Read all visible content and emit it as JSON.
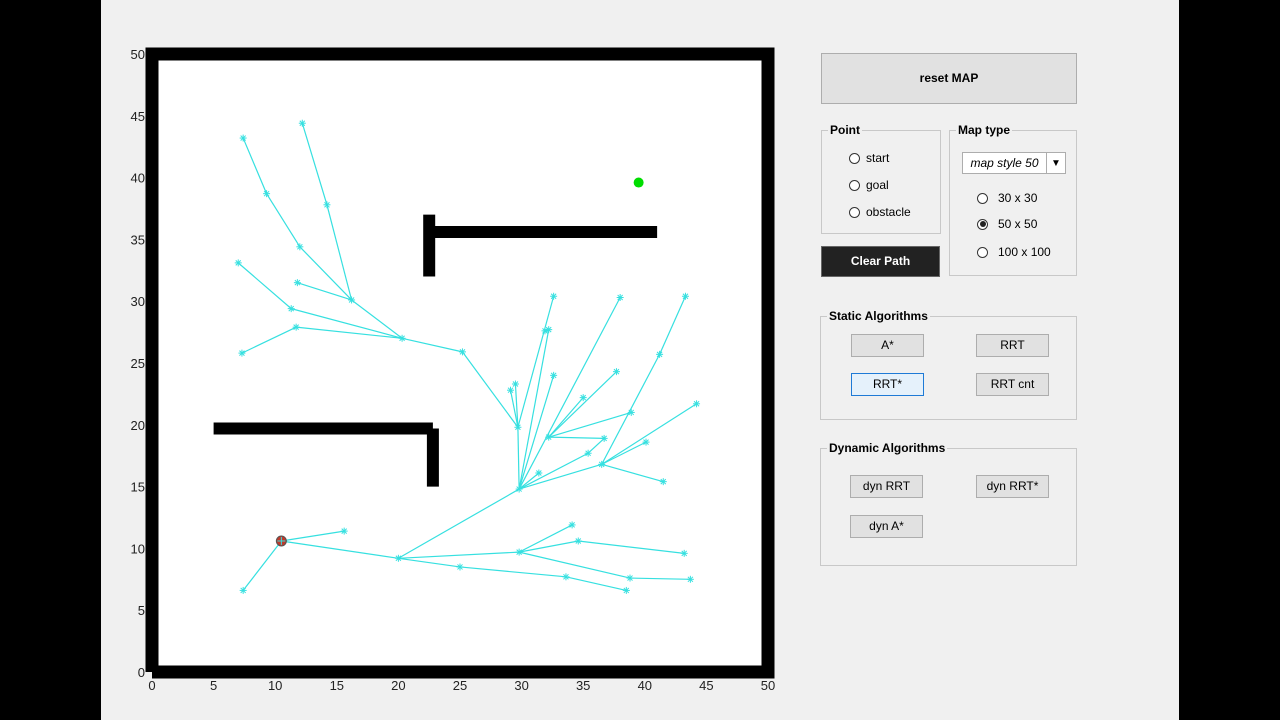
{
  "axes": {
    "xticks": [
      "0",
      "5",
      "10",
      "15",
      "20",
      "25",
      "30",
      "35",
      "40",
      "45",
      "50"
    ],
    "yticks": [
      "0",
      "5",
      "10",
      "15",
      "20",
      "25",
      "30",
      "35",
      "40",
      "45",
      "50"
    ],
    "tree_color": "#36e0e0",
    "start_color": "#c0392b",
    "goal_color": "#00dd00"
  },
  "controls": {
    "reset_label": "reset  MAP",
    "point_title": "Point",
    "point_options": [
      "start",
      "goal",
      "obstacle"
    ],
    "maptype_title": "Map type",
    "map_select_value": "map style 50",
    "size_options": [
      "30 x 30",
      "50 x 50",
      "100 x 100"
    ],
    "size_selected": "50 x 50",
    "clear_label": "Clear Path",
    "static_title": "Static Algorithms",
    "astar_label": "A*",
    "rrt_label": "RRT",
    "rrtstar_label": "RRT*",
    "rrtcnt_label": "RRT cnt",
    "dynamic_title": "Dynamic Algorithms",
    "dynrrt_label": "dyn RRT",
    "dynrrtstar_label": "dyn RRT*",
    "dynastar_label": "dyn A*"
  },
  "chart_data": {
    "type": "scatter",
    "xlim": [
      0,
      50
    ],
    "ylim": [
      0,
      50
    ],
    "start": [
      10.5,
      10.6
    ],
    "goal": [
      39.5,
      39.6
    ],
    "obstacles": [
      [
        [
          0,
          0
        ],
        [
          50,
          0
        ],
        [
          50,
          50
        ],
        [
          0,
          50
        ],
        [
          0,
          0
        ]
      ],
      [
        [
          22.5,
          32
        ],
        [
          22.5,
          37
        ]
      ],
      [
        [
          22.5,
          35.6
        ],
        [
          41,
          35.6
        ]
      ],
      [
        [
          5,
          19.7
        ],
        [
          22.8,
          19.7
        ]
      ],
      [
        [
          22.8,
          15
        ],
        [
          22.8,
          19.7
        ]
      ]
    ],
    "nodes": [
      [
        10.5,
        10.6
      ],
      [
        7.4,
        6.6
      ],
      [
        15.6,
        11.4
      ],
      [
        20,
        9.2
      ],
      [
        25,
        8.5
      ],
      [
        33.6,
        7.7
      ],
      [
        38.5,
        6.6
      ],
      [
        29.8,
        9.7
      ],
      [
        34.1,
        11.9
      ],
      [
        34.6,
        10.6
      ],
      [
        43.2,
        9.6
      ],
      [
        38.8,
        7.6
      ],
      [
        43.7,
        7.5
      ],
      [
        29.8,
        14.8
      ],
      [
        31.4,
        16.1
      ],
      [
        36.5,
        16.8
      ],
      [
        41.5,
        15.4
      ],
      [
        40.1,
        18.6
      ],
      [
        44.2,
        21.7
      ],
      [
        35.4,
        17.7
      ],
      [
        36.7,
        18.9
      ],
      [
        32.2,
        19.0
      ],
      [
        35.0,
        22.2
      ],
      [
        38.9,
        21.0
      ],
      [
        37.7,
        24.3
      ],
      [
        32.6,
        24.0
      ],
      [
        32.2,
        27.7
      ],
      [
        29.7,
        19.8
      ],
      [
        29.5,
        23.3
      ],
      [
        29.1,
        22.8
      ],
      [
        32.6,
        30.4
      ],
      [
        38.0,
        30.3
      ],
      [
        41.2,
        25.7
      ],
      [
        43.3,
        30.4
      ],
      [
        31.9,
        27.6
      ],
      [
        25.2,
        25.9
      ],
      [
        20.3,
        27.0
      ],
      [
        11.7,
        27.9
      ],
      [
        7.3,
        25.8
      ],
      [
        11.3,
        29.4
      ],
      [
        16.2,
        30.1
      ],
      [
        11.8,
        31.5
      ],
      [
        7.0,
        33.1
      ],
      [
        12.0,
        34.4
      ],
      [
        9.3,
        38.7
      ],
      [
        7.4,
        43.2
      ],
      [
        14.2,
        37.8
      ],
      [
        12.2,
        44.4
      ]
    ],
    "edges": [
      [
        0,
        1
      ],
      [
        0,
        2
      ],
      [
        0,
        3
      ],
      [
        3,
        4
      ],
      [
        4,
        5
      ],
      [
        5,
        6
      ],
      [
        3,
        7
      ],
      [
        7,
        8
      ],
      [
        7,
        9
      ],
      [
        9,
        10
      ],
      [
        7,
        11
      ],
      [
        11,
        12
      ],
      [
        3,
        13
      ],
      [
        13,
        14
      ],
      [
        13,
        15
      ],
      [
        15,
        16
      ],
      [
        15,
        17
      ],
      [
        15,
        18
      ],
      [
        13,
        19
      ],
      [
        19,
        20
      ],
      [
        20,
        21
      ],
      [
        21,
        22
      ],
      [
        21,
        23
      ],
      [
        21,
        24
      ],
      [
        13,
        25
      ],
      [
        13,
        26
      ],
      [
        26,
        34
      ],
      [
        13,
        27
      ],
      [
        27,
        28
      ],
      [
        27,
        29
      ],
      [
        27,
        35
      ],
      [
        27,
        30
      ],
      [
        13,
        31
      ],
      [
        15,
        32
      ],
      [
        32,
        33
      ],
      [
        35,
        36
      ],
      [
        36,
        37
      ],
      [
        37,
        38
      ],
      [
        36,
        39
      ],
      [
        36,
        40
      ],
      [
        40,
        41
      ],
      [
        39,
        42
      ],
      [
        40,
        43
      ],
      [
        43,
        44
      ],
      [
        44,
        45
      ],
      [
        40,
        46
      ],
      [
        46,
        47
      ]
    ]
  }
}
